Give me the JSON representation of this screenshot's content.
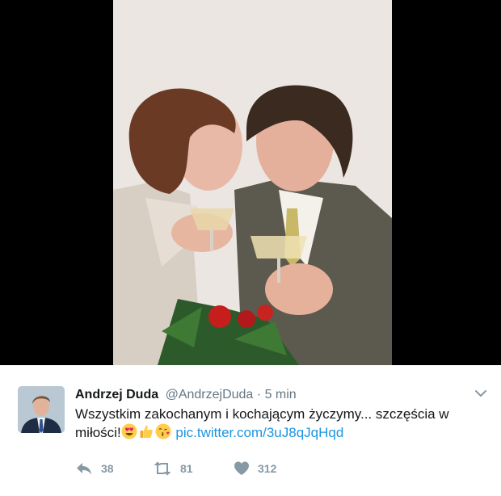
{
  "tweet": {
    "author_name": "Andrzej Duda",
    "handle": "@AndrzejDuda",
    "separator": "·",
    "time": "5 min",
    "text_line1": "Wszystkim zakochanym i kochającym życzymy... szczęścia w",
    "text_line2": "miłości!",
    "emojis": [
      "heart-eyes-emoji",
      "thumbs-up-emoji",
      "kiss-heart-emoji"
    ],
    "link": "pic.twitter.com/3uJ8qJqHqd"
  },
  "actions": {
    "reply_count": "38",
    "retweet_count": "81",
    "like_count": "312"
  },
  "colors": {
    "link": "#1b95e0",
    "muted": "#657786",
    "action_icon": "#8899a6"
  },
  "icons": [
    "chevron-down-icon",
    "reply-icon",
    "retweet-icon",
    "heart-icon"
  ]
}
